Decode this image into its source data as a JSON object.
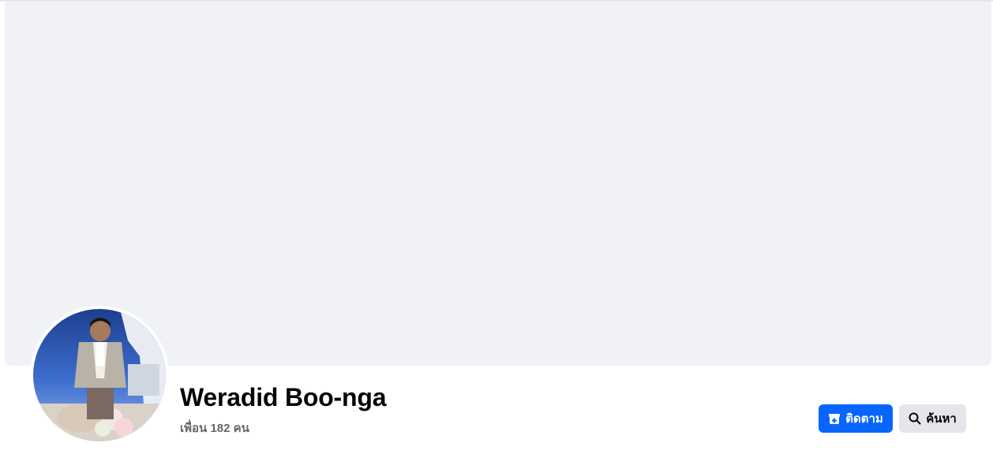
{
  "profile": {
    "name": "Weradid Boo-nga",
    "friends_text": "เพื่อน 182 คน"
  },
  "actions": {
    "follow_label": "ติดตาม",
    "search_label": "ค้นหา"
  },
  "icons": {
    "follow": "follow-plus-icon",
    "search": "search-icon"
  },
  "colors": {
    "cover_bg": "#f0f2f5",
    "primary_button": "#0866ff",
    "secondary_button": "#e4e6eb",
    "name_text": "#050505",
    "secondary_text": "#65676b"
  }
}
